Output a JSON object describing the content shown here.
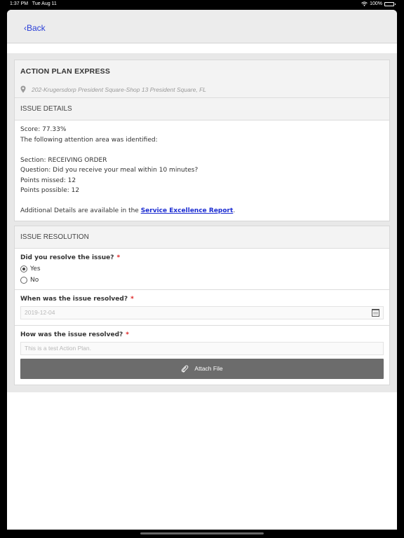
{
  "status_bar": {
    "time": "1:37 PM",
    "date": "Tue Aug 11",
    "battery": "100%"
  },
  "nav": {
    "back_label": "‹Back"
  },
  "store": {
    "title": "ACTION PLAN EXPRESS",
    "address": "202-Krugersdorp President Square-Shop 13 President Square, FL"
  },
  "issue": {
    "heading": "ISSUE DETAILS",
    "score": "Score: 77.33%",
    "intro": "The following attention area was identified:",
    "section": "Section: RECEIVING ORDER",
    "question": "Question: Did you receive your meal within 10 minutes?",
    "points_missed": "Points missed: 12",
    "points_possible": "Points possible: 12",
    "details_prefix": "Additional Details are available in the ",
    "details_link": "Service Excellence Report",
    "details_suffix": "."
  },
  "resolution": {
    "heading": "ISSUE RESOLUTION",
    "q1": {
      "label": "Did you resolve the issue?",
      "required": "*",
      "options": [
        "Yes",
        "No"
      ],
      "selected": "Yes"
    },
    "q2": {
      "label": "When was the issue resolved?",
      "required": "*",
      "placeholder": "2019-12-04"
    },
    "q3": {
      "label": "How was the issue resolved?",
      "required": "*",
      "placeholder": "This is a test Action Plan."
    },
    "attach_label": "Attach File"
  },
  "icons": {
    "location": "location-pin-icon",
    "calendar": "calendar-icon",
    "attach": "paperclip-icon"
  }
}
